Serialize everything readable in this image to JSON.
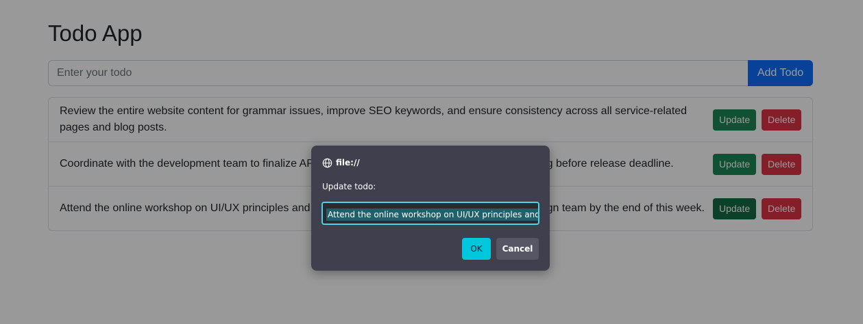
{
  "app": {
    "title": "Todo App",
    "input_placeholder": "Enter your todo",
    "add_label": "Add Todo"
  },
  "todos": [
    {
      "text": "Review the entire website content for grammar issues, improve SEO keywords, and ensure consistency across all service-related pages and blog posts.",
      "update_label": "Update",
      "delete_label": "Delete"
    },
    {
      "text": "Coordinate with the development team to finalize API documentation, and schedule integration testing before release deadline.",
      "update_label": "Update",
      "delete_label": "Delete"
    },
    {
      "text": "Attend the online workshop on UI/UX principles and prepare a summary report to share with the design team by the end of this week.",
      "update_label": "Update",
      "delete_label": "Delete"
    }
  ],
  "dialog": {
    "origin": "file://",
    "message": "Update todo:",
    "value": "Attend the online workshop on UI/UX principles and prep",
    "ok_label": "OK",
    "cancel_label": "Cancel"
  },
  "colors": {
    "primary": "#0d6efd",
    "success": "#198754",
    "danger": "#dc3545",
    "dialog_bg": "#403f4d",
    "dialog_accent": "#00c8dc"
  },
  "icons": {
    "origin": "globe-icon"
  }
}
